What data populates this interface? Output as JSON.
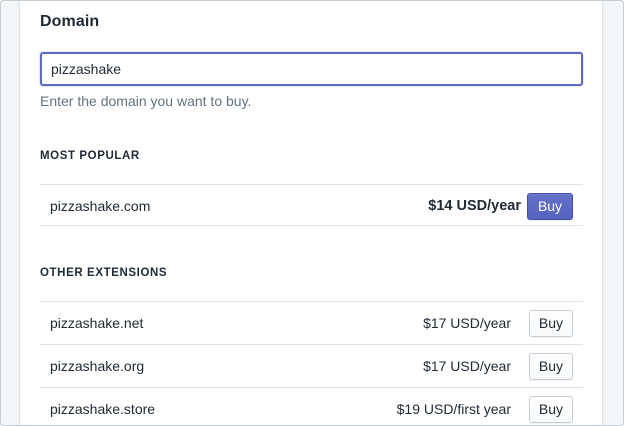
{
  "section": {
    "title": "Domain"
  },
  "search": {
    "value": "pizzashake",
    "placeholder": "",
    "help_text": "Enter the domain you want to buy."
  },
  "most_popular": {
    "label": "MOST POPULAR",
    "items": [
      {
        "domain": "pizzashake.com",
        "price": "$14 USD/year",
        "button": "Buy"
      }
    ]
  },
  "other_extensions": {
    "label": "OTHER EXTENSIONS",
    "items": [
      {
        "domain": "pizzashake.net",
        "price": "$17 USD/year",
        "button": "Buy"
      },
      {
        "domain": "pizzashake.org",
        "price": "$17 USD/year",
        "button": "Buy"
      },
      {
        "domain": "pizzashake.store",
        "price": "$19 USD/first year",
        "button": "Buy"
      }
    ]
  },
  "colors": {
    "accent": "#5c6ac4",
    "text": "#212b36",
    "muted": "#637381",
    "border": "#dfe3e8"
  }
}
